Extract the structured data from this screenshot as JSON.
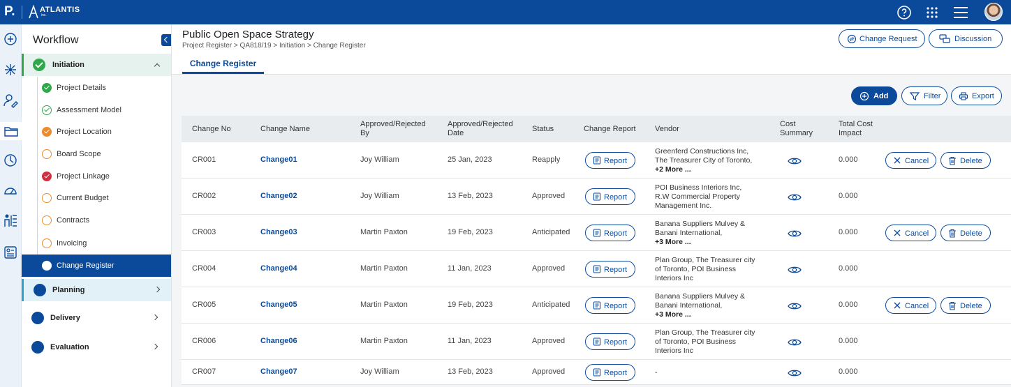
{
  "brand": {
    "logo_letter": "P.",
    "name": "ATLANTIS",
    "sub": "inc."
  },
  "sidebar": {
    "title": "Workflow",
    "stages": [
      {
        "label": "Initiation",
        "state": "expanded"
      },
      {
        "label": "Planning",
        "state": "collapsed"
      },
      {
        "label": "Delivery",
        "state": "collapsed"
      },
      {
        "label": "Evaluation",
        "state": "collapsed"
      }
    ],
    "steps": [
      {
        "label": "Project Details",
        "status": "complete"
      },
      {
        "label": "Assessment Model",
        "status": "complete-outline"
      },
      {
        "label": "Project Location",
        "status": "warning"
      },
      {
        "label": "Board Scope",
        "status": "open"
      },
      {
        "label": "Project Linkage",
        "status": "error"
      },
      {
        "label": "Current Budget",
        "status": "open"
      },
      {
        "label": "Contracts",
        "status": "open"
      },
      {
        "label": "Invoicing",
        "status": "open"
      },
      {
        "label": "Change Register",
        "status": "current"
      }
    ]
  },
  "header": {
    "title": "Public Open Space Strategy",
    "breadcrumb": "Project Register > QA818/19 > Initiation > Change Register",
    "tab": "Change Register",
    "change_request": "Change Request",
    "discussion": "Discussion"
  },
  "toolbar": {
    "add": "Add",
    "filter": "Filter",
    "export": "Export"
  },
  "table": {
    "headers": {
      "change_no": "Change No",
      "change_name": "Change Name",
      "approved_by": [
        "Approved/Rejected",
        "By"
      ],
      "approved_date": [
        "Approved/Rejected",
        "Date"
      ],
      "status": "Status",
      "change_report": "Change Report",
      "vendor": "Vendor",
      "cost_summary": [
        "Cost",
        "Summary"
      ],
      "total_cost": [
        "Total Cost",
        "Impact"
      ]
    },
    "report_label": "Report",
    "cancel_label": "Cancel",
    "delete_label": "Delete",
    "rows": [
      {
        "no": "CR001",
        "name": "Change01",
        "by": "Joy William",
        "date": "25 Jan, 2023",
        "status": "Reapply",
        "vendor": [
          "Greenferd Constructions Inc,",
          "The Treasurer City of Toronto,"
        ],
        "more": "+2 More ...",
        "cost": "0.000",
        "actions": true
      },
      {
        "no": "CR002",
        "name": "Change02",
        "by": "Joy William",
        "date": "13 Feb, 2023",
        "status": "Approved",
        "vendor": [
          "POI Business Interiors Inc,",
          "R.W Commercial Property",
          "Management Inc."
        ],
        "more": "",
        "cost": "0.000",
        "actions": false
      },
      {
        "no": "CR003",
        "name": "Change03",
        "by": "Martin Paxton",
        "date": "19 Feb, 2023",
        "status": "Anticipated",
        "vendor": [
          "Banana Suppliers Mulvey &",
          "Banani International,"
        ],
        "more": "+3 More ...",
        "cost": "0.000",
        "actions": true
      },
      {
        "no": "CR004",
        "name": "Change04",
        "by": "Martin Paxton",
        "date": "11 Jan, 2023",
        "status": "Approved",
        "vendor": [
          "Plan Group, The Treasurer city",
          "of Toronto, POI Business",
          "Interiors Inc"
        ],
        "more": "",
        "cost": "0.000",
        "actions": false
      },
      {
        "no": "CR005",
        "name": "Change05",
        "by": "Martin Paxton",
        "date": "19 Feb, 2023",
        "status": "Anticipated",
        "vendor": [
          "Banana Suppliers Mulvey &",
          "Banani International,"
        ],
        "more": "+3 More ...",
        "cost": "0.000",
        "actions": true
      },
      {
        "no": "CR006",
        "name": "Change06",
        "by": "Martin Paxton",
        "date": "11 Jan, 2023",
        "status": "Approved",
        "vendor": [
          "Plan Group, The Treasurer city",
          "of Toronto, POI Business",
          "Interiors Inc"
        ],
        "more": "",
        "cost": "0.000",
        "actions": false
      },
      {
        "no": "CR007",
        "name": "Change07",
        "by": "Joy William",
        "date": "13 Feb, 2023",
        "status": "Approved",
        "vendor": [
          "-"
        ],
        "more": "",
        "cost": "0.000",
        "actions": false
      }
    ]
  },
  "colors": {
    "primary": "#0b4a9a",
    "success": "#2ea84a",
    "warning": "#ee8a2a",
    "error": "#d32f3f"
  }
}
